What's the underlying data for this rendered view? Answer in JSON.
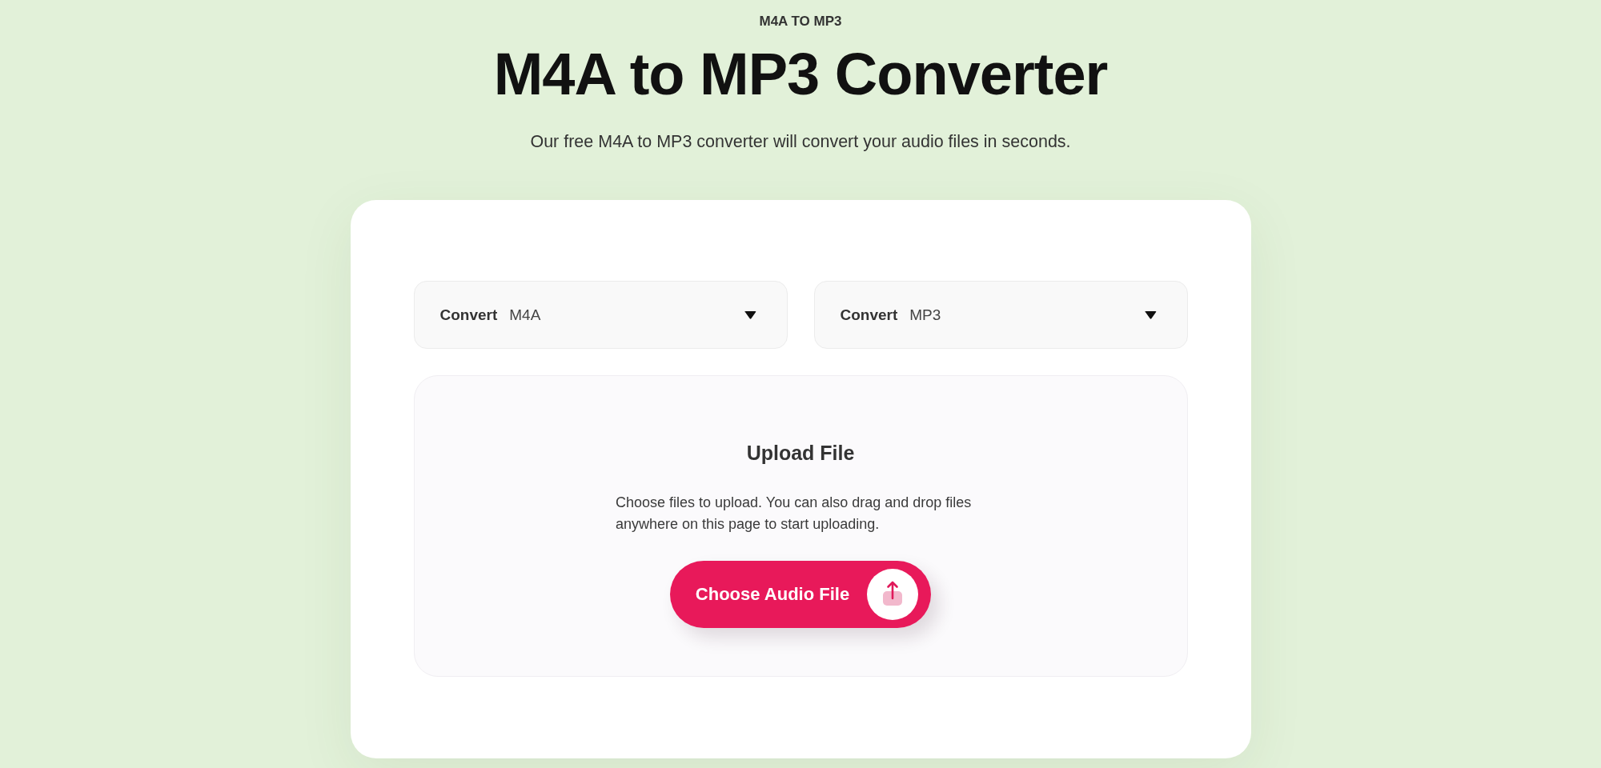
{
  "header": {
    "eyebrow": "M4A TO MP3",
    "title": "M4A to MP3 Converter",
    "subtitle": "Our free M4A to MP3 converter will convert your audio files in seconds."
  },
  "converter": {
    "selects": [
      {
        "label": "Convert",
        "value": "M4A"
      },
      {
        "label": "Convert",
        "value": "MP3"
      }
    ],
    "upload": {
      "title": "Upload File",
      "description": "Choose files to upload. You can also drag and drop files anywhere on this page to start uploading.",
      "button": "Choose Audio File"
    }
  }
}
